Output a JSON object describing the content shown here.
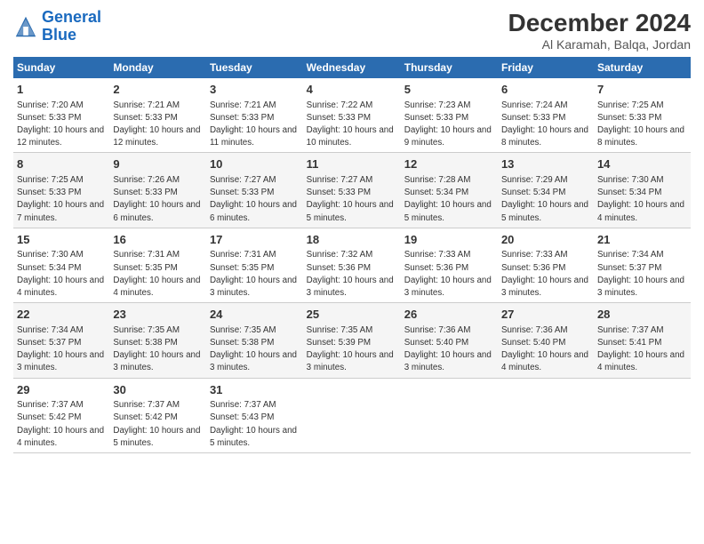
{
  "header": {
    "logo_general": "General",
    "logo_blue": "Blue",
    "title": "December 2024",
    "subtitle": "Al Karamah, Balqa, Jordan"
  },
  "days_of_week": [
    "Sunday",
    "Monday",
    "Tuesday",
    "Wednesday",
    "Thursday",
    "Friday",
    "Saturday"
  ],
  "weeks": [
    [
      {
        "day": "1",
        "info": "Sunrise: 7:20 AM\nSunset: 5:33 PM\nDaylight: 10 hours and 12 minutes."
      },
      {
        "day": "2",
        "info": "Sunrise: 7:21 AM\nSunset: 5:33 PM\nDaylight: 10 hours and 12 minutes."
      },
      {
        "day": "3",
        "info": "Sunrise: 7:21 AM\nSunset: 5:33 PM\nDaylight: 10 hours and 11 minutes."
      },
      {
        "day": "4",
        "info": "Sunrise: 7:22 AM\nSunset: 5:33 PM\nDaylight: 10 hours and 10 minutes."
      },
      {
        "day": "5",
        "info": "Sunrise: 7:23 AM\nSunset: 5:33 PM\nDaylight: 10 hours and 9 minutes."
      },
      {
        "day": "6",
        "info": "Sunrise: 7:24 AM\nSunset: 5:33 PM\nDaylight: 10 hours and 8 minutes."
      },
      {
        "day": "7",
        "info": "Sunrise: 7:25 AM\nSunset: 5:33 PM\nDaylight: 10 hours and 8 minutes."
      }
    ],
    [
      {
        "day": "8",
        "info": "Sunrise: 7:25 AM\nSunset: 5:33 PM\nDaylight: 10 hours and 7 minutes."
      },
      {
        "day": "9",
        "info": "Sunrise: 7:26 AM\nSunset: 5:33 PM\nDaylight: 10 hours and 6 minutes."
      },
      {
        "day": "10",
        "info": "Sunrise: 7:27 AM\nSunset: 5:33 PM\nDaylight: 10 hours and 6 minutes."
      },
      {
        "day": "11",
        "info": "Sunrise: 7:27 AM\nSunset: 5:33 PM\nDaylight: 10 hours and 5 minutes."
      },
      {
        "day": "12",
        "info": "Sunrise: 7:28 AM\nSunset: 5:34 PM\nDaylight: 10 hours and 5 minutes."
      },
      {
        "day": "13",
        "info": "Sunrise: 7:29 AM\nSunset: 5:34 PM\nDaylight: 10 hours and 5 minutes."
      },
      {
        "day": "14",
        "info": "Sunrise: 7:30 AM\nSunset: 5:34 PM\nDaylight: 10 hours and 4 minutes."
      }
    ],
    [
      {
        "day": "15",
        "info": "Sunrise: 7:30 AM\nSunset: 5:34 PM\nDaylight: 10 hours and 4 minutes."
      },
      {
        "day": "16",
        "info": "Sunrise: 7:31 AM\nSunset: 5:35 PM\nDaylight: 10 hours and 4 minutes."
      },
      {
        "day": "17",
        "info": "Sunrise: 7:31 AM\nSunset: 5:35 PM\nDaylight: 10 hours and 3 minutes."
      },
      {
        "day": "18",
        "info": "Sunrise: 7:32 AM\nSunset: 5:36 PM\nDaylight: 10 hours and 3 minutes."
      },
      {
        "day": "19",
        "info": "Sunrise: 7:33 AM\nSunset: 5:36 PM\nDaylight: 10 hours and 3 minutes."
      },
      {
        "day": "20",
        "info": "Sunrise: 7:33 AM\nSunset: 5:36 PM\nDaylight: 10 hours and 3 minutes."
      },
      {
        "day": "21",
        "info": "Sunrise: 7:34 AM\nSunset: 5:37 PM\nDaylight: 10 hours and 3 minutes."
      }
    ],
    [
      {
        "day": "22",
        "info": "Sunrise: 7:34 AM\nSunset: 5:37 PM\nDaylight: 10 hours and 3 minutes."
      },
      {
        "day": "23",
        "info": "Sunrise: 7:35 AM\nSunset: 5:38 PM\nDaylight: 10 hours and 3 minutes."
      },
      {
        "day": "24",
        "info": "Sunrise: 7:35 AM\nSunset: 5:38 PM\nDaylight: 10 hours and 3 minutes."
      },
      {
        "day": "25",
        "info": "Sunrise: 7:35 AM\nSunset: 5:39 PM\nDaylight: 10 hours and 3 minutes."
      },
      {
        "day": "26",
        "info": "Sunrise: 7:36 AM\nSunset: 5:40 PM\nDaylight: 10 hours and 3 minutes."
      },
      {
        "day": "27",
        "info": "Sunrise: 7:36 AM\nSunset: 5:40 PM\nDaylight: 10 hours and 4 minutes."
      },
      {
        "day": "28",
        "info": "Sunrise: 7:37 AM\nSunset: 5:41 PM\nDaylight: 10 hours and 4 minutes."
      }
    ],
    [
      {
        "day": "29",
        "info": "Sunrise: 7:37 AM\nSunset: 5:42 PM\nDaylight: 10 hours and 4 minutes."
      },
      {
        "day": "30",
        "info": "Sunrise: 7:37 AM\nSunset: 5:42 PM\nDaylight: 10 hours and 5 minutes."
      },
      {
        "day": "31",
        "info": "Sunrise: 7:37 AM\nSunset: 5:43 PM\nDaylight: 10 hours and 5 minutes."
      },
      {
        "day": "",
        "info": ""
      },
      {
        "day": "",
        "info": ""
      },
      {
        "day": "",
        "info": ""
      },
      {
        "day": "",
        "info": ""
      }
    ]
  ]
}
